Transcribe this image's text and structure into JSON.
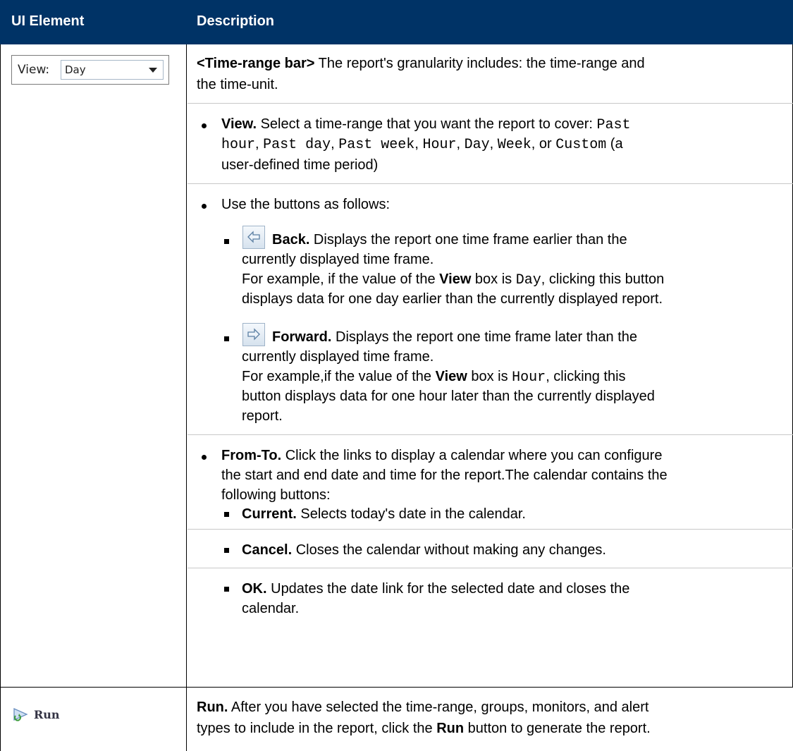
{
  "header": {
    "col1": "UI Element",
    "col2": "Description"
  },
  "view_control": {
    "label": "View:",
    "value": "Day"
  },
  "intro": {
    "bold": "<Time-range bar>",
    "line1": " The report's granularity includes: the time-range and",
    "line2": "the time-unit."
  },
  "view_item": {
    "bold": "View.",
    "t1": " Select a time-range that you want the report to cover: ",
    "m1": "Past",
    "m2": "hour",
    "c1": ", ",
    "m3": "Past day",
    "c2": ", ",
    "m4": "Past week",
    "c3": ", ",
    "m5": "Hour",
    "c4": ", ",
    "m6": "Day",
    "c5": ", ",
    "m7": "Week",
    "c6": ", ",
    "or": "or",
    "m8": "Custom",
    "t2": " (a",
    "line3": "user-defined time period)"
  },
  "buttons_intro": "Use the buttons as follows:",
  "back": {
    "bold": "Back.",
    "l1": " Displays the report one time frame earlier than the",
    "l2": "currently displayed time frame.",
    "l3a": "For example, if the value of the ",
    "l3b": "View",
    "l3c": " box is ",
    "l3d": "Day",
    "l3e": ", clicking this button",
    "l4": "displays data for one day earlier than the currently displayed report."
  },
  "forward": {
    "bold": "Forward.",
    "l1": " Displays the report one time frame later than the",
    "l2": "currently displayed time frame.",
    "l3a": "For example,if the value of the ",
    "l3b": "View",
    "l3c": " box is ",
    "l3d": "Hour",
    "l3e": ", clicking this",
    "l4": "button displays data for one hour later than the currently displayed",
    "l5": "report."
  },
  "fromto": {
    "bold": "From-To.",
    "l1": " Click the links to display a calendar where you can configure",
    "l2": "the start and end date and time for the report.The calendar contains the",
    "l3": "following buttons:"
  },
  "current": {
    "bold": "Current.",
    "text": " Selects today's date in the calendar."
  },
  "cancel": {
    "bold": "Cancel.",
    "text": " Closes the calendar without making any changes."
  },
  "ok": {
    "bold": "OK.",
    "l1": " Updates the date link for the selected date and closes the",
    "l2": "calendar."
  },
  "run": {
    "button_label": "Run",
    "bold": "Run.",
    "l1": " After you have selected the time-range, groups, monitors, and alert",
    "l2a": "types to include in the report, click the ",
    "l2b": "Run",
    "l2c": " button to generate the report."
  },
  "colors": {
    "header_bg": "#003366",
    "header_text": "#ffffff"
  }
}
